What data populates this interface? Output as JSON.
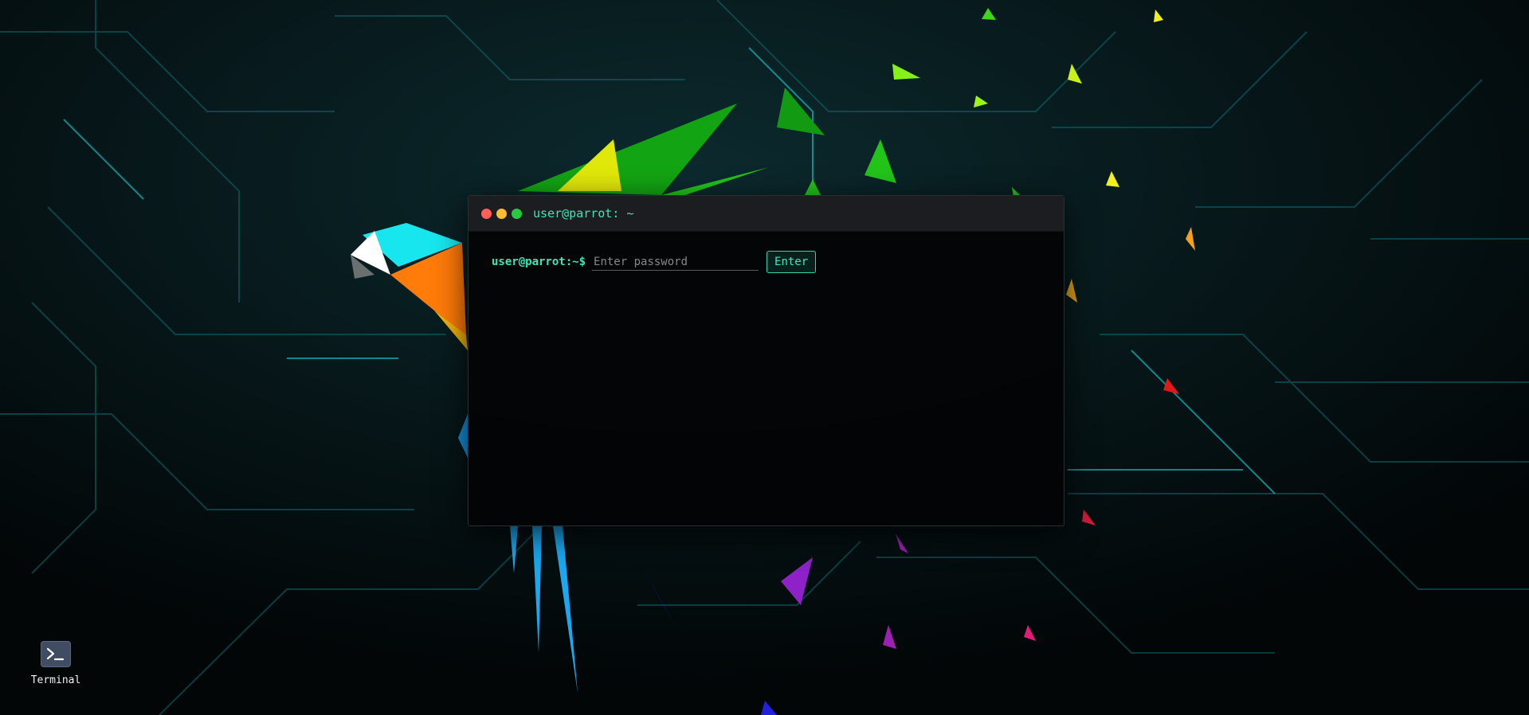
{
  "desktop": {
    "icons": [
      {
        "label": "Terminal",
        "icon": "terminal-icon"
      }
    ]
  },
  "terminal": {
    "title": "user@parrot: ~",
    "prompt": "user@parrot:~$",
    "password_placeholder": "Enter password",
    "password_value": "",
    "enter_label": "Enter"
  },
  "colors": {
    "accent": "#3ee6b6",
    "close": "#ff5f57",
    "minimize": "#febc2e",
    "maximize": "#28c840",
    "background": "#020607",
    "circuit": "#0f6a70"
  }
}
